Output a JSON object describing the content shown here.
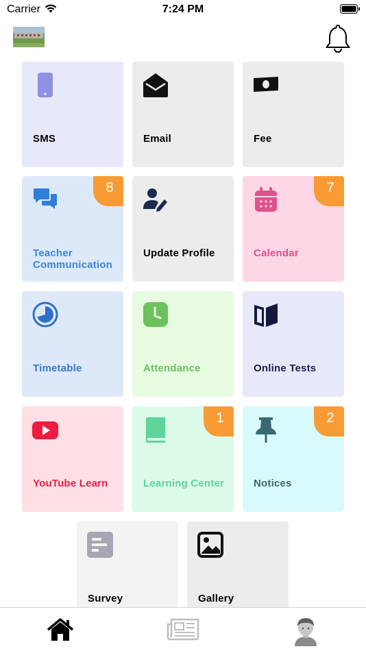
{
  "status_bar": {
    "carrier": "Carrier",
    "time": "7:24 PM"
  },
  "header": {
    "logo_icon": "school-building-photo",
    "notifications_icon": "bell-icon"
  },
  "tiles": [
    {
      "label": "SMS",
      "icon": "phone-icon",
      "bg": "#e8e8fb",
      "label_color": "#000000"
    },
    {
      "label": "Email",
      "icon": "envelope-open-icon",
      "bg": "#ececec",
      "label_color": "#000000"
    },
    {
      "label": "Fee",
      "icon": "banknote-icon",
      "bg": "#ececec",
      "label_color": "#000000"
    },
    {
      "label": "Teacher\nCommunication",
      "icon": "chat-icon",
      "bg": "#dde9f9",
      "label_color": "#3a86d6",
      "badge": "8"
    },
    {
      "label": "Update Profile",
      "icon": "user-edit-icon",
      "bg": "#ececec",
      "label_color": "#000000"
    },
    {
      "label": "Calendar",
      "icon": "calendar-icon",
      "bg": "#fdd7e6",
      "label_color": "#e0528a",
      "badge": "7"
    },
    {
      "label": "Timetable",
      "icon": "clock-pie-icon",
      "bg": "#dde9f9",
      "label_color": "#3b79c9"
    },
    {
      "label": "Attendance",
      "icon": "clock-icon",
      "bg": "#e6fbe0",
      "label_color": "#6cc15c"
    },
    {
      "label": "Online Tests",
      "icon": "book-open-icon",
      "bg": "#e8e8fb",
      "label_color": "#1a2050"
    },
    {
      "label": "YouTube Learn",
      "icon": "youtube-icon",
      "bg": "#ffe0e6",
      "label_color": "#ee1d3f"
    },
    {
      "label": "Learning Center",
      "icon": "book-icon",
      "bg": "#dcfae8",
      "label_color": "#5fd39a",
      "badge": "1"
    },
    {
      "label": "Notices",
      "icon": "pushpin-icon",
      "bg": "#d8fafc",
      "label_color": "#3b6970",
      "badge": "2"
    },
    {
      "label": "Survey",
      "icon": "survey-icon",
      "bg": "#f3f3f3",
      "label_color": "#000000"
    },
    {
      "label": "Gallery",
      "icon": "image-icon",
      "bg": "#ececec",
      "label_color": "#000000"
    }
  ],
  "tab_bar": {
    "tabs": [
      {
        "name": "home",
        "icon": "home-icon"
      },
      {
        "name": "news",
        "icon": "newspaper-icon"
      },
      {
        "name": "profile",
        "icon": "avatar-icon"
      }
    ]
  }
}
